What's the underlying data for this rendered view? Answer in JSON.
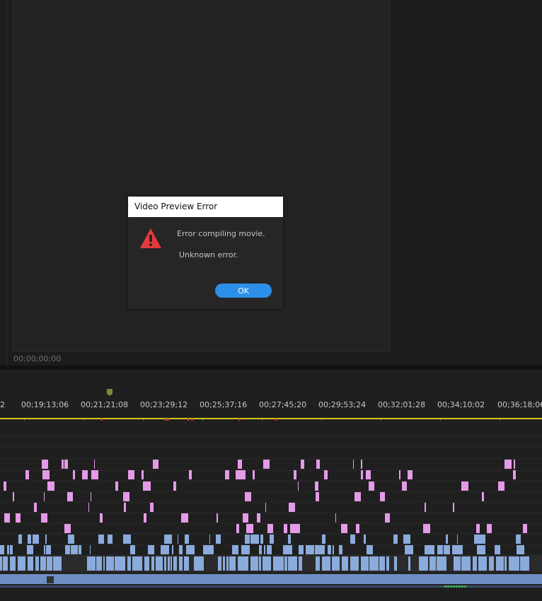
{
  "monitor": {
    "timecode": "00;00;00;00"
  },
  "timeline": {
    "ruler_labels": [
      "2",
      "00;19;13;06",
      "00;21;21;08",
      "00;23;29;12",
      "00;25;37;16",
      "00;27;45;20",
      "00;29;53;24",
      "00;32;01;28",
      "00;34;10;02",
      "00;36;18;06"
    ],
    "colors": {
      "audio_clip": "#e49be7",
      "video_clip": "#8aabdb",
      "work_area": "#d6c51d",
      "marker": "#b53a3a"
    }
  },
  "dialog": {
    "title": "Video Preview Error",
    "message": "Error compiling movie.",
    "detail": "Unknown error.",
    "ok_label": "OK",
    "icon": "warning-icon",
    "colors": {
      "warning": "#e23b3b",
      "button": "#2c8fea"
    }
  }
}
